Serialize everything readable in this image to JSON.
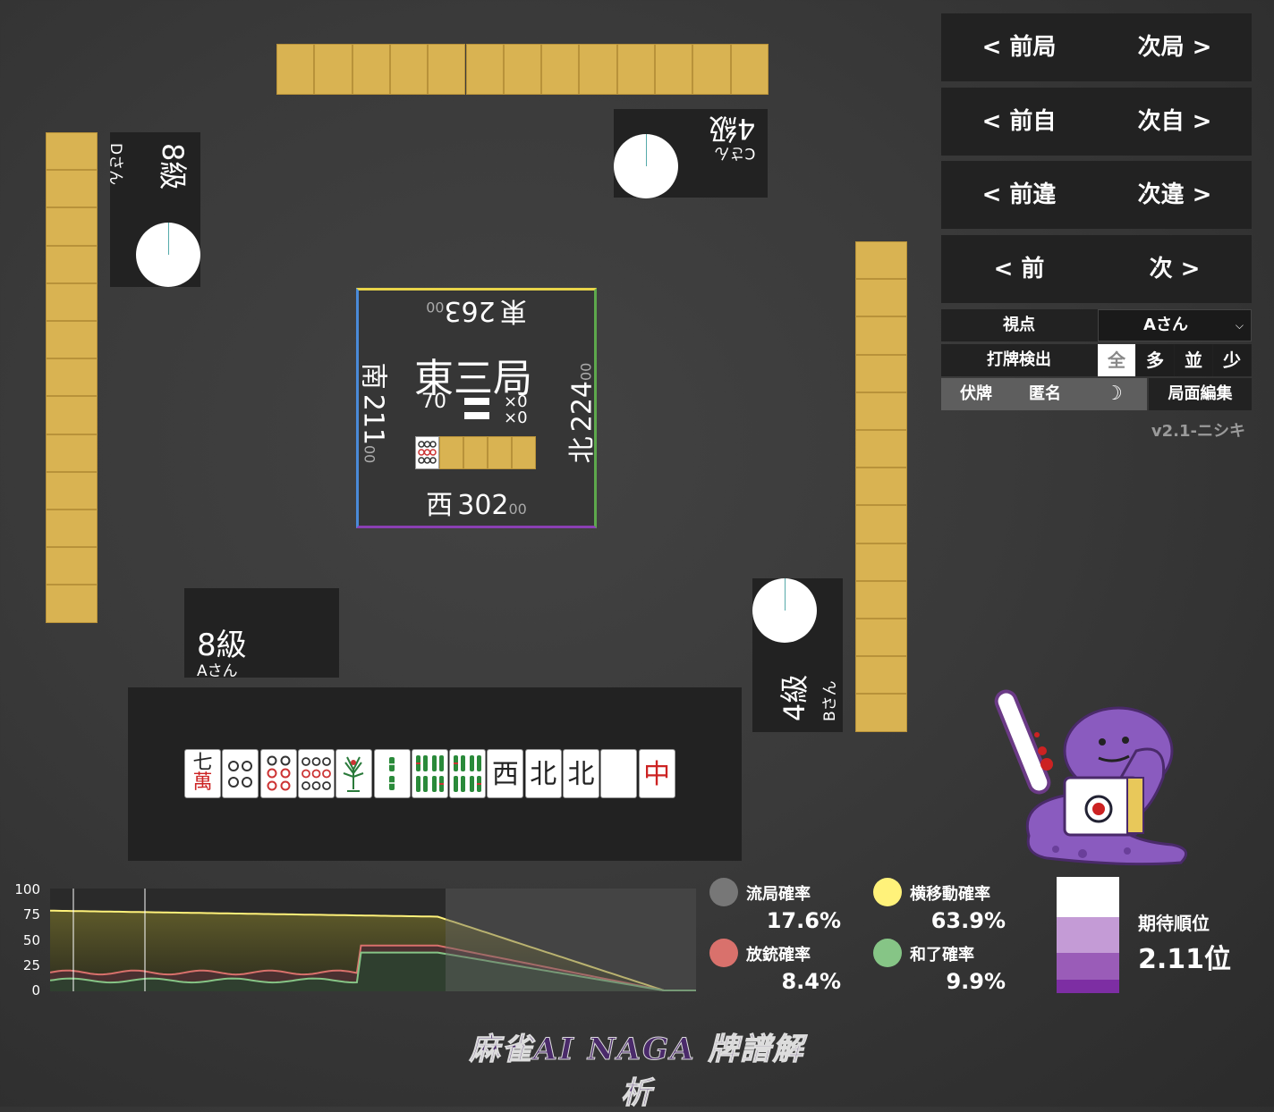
{
  "nav": {
    "prev_round": "< 前局",
    "next_round": "次局 >",
    "prev_self": "< 前自",
    "next_self": "次自 >",
    "prev_diff": "< 前違",
    "next_diff": "次違 >",
    "prev": "< 前",
    "next": "次 >"
  },
  "settings": {
    "viewpoint_label": "視点",
    "viewpoint_value": "Aさん",
    "detect_label": "打牌検出",
    "detect_options": [
      "全",
      "多",
      "並",
      "少"
    ],
    "hide_tiles": "伏牌",
    "anonymous": "匿名",
    "moon_icon": "☽",
    "edit_position": "局面編集",
    "version": "v2.1-ニシキ"
  },
  "players": {
    "a": {
      "rank": "8級",
      "name": "Aさん"
    },
    "b": {
      "rank": "4級",
      "name": "Bさん"
    },
    "c": {
      "rank": "4級",
      "name": "Cさん"
    },
    "d": {
      "rank": "8級",
      "name": "Dさん"
    }
  },
  "center": {
    "round": "東三局",
    "remaining": "70",
    "honba": "×0",
    "riichi": "×0",
    "east": {
      "wind": "東",
      "score": "263",
      "suffix": "00"
    },
    "south": {
      "wind": "南",
      "score": "211",
      "suffix": "00"
    },
    "west": {
      "wind": "西",
      "score": "302",
      "suffix": "00"
    },
    "north": {
      "wind": "北",
      "score": "224",
      "suffix": "00"
    }
  },
  "hand": [
    "七萬",
    "2p",
    "6p",
    "9p",
    "1s",
    "2s",
    "8s",
    "8s",
    "西",
    "北",
    "北",
    "白",
    "中"
  ],
  "chart": {
    "yticks": [
      "100",
      "75",
      "50",
      "25",
      "0"
    ]
  },
  "stats": {
    "ryukyoku": {
      "label": "流局確率",
      "value": "17.6%",
      "color": "#777777"
    },
    "yoko": {
      "label": "横移動確率",
      "value": "63.9%",
      "color": "#fff27a"
    },
    "houju": {
      "label": "放銃確率",
      "value": "8.4%",
      "color": "#d9716c"
    },
    "hora": {
      "label": "和了確率",
      "value": "9.9%",
      "color": "#86c586"
    },
    "expected_label": "期待順位",
    "expected_value": "2.11位"
  },
  "footer": {
    "logo": "麻雀AI NAGA 牌譜解析"
  }
}
